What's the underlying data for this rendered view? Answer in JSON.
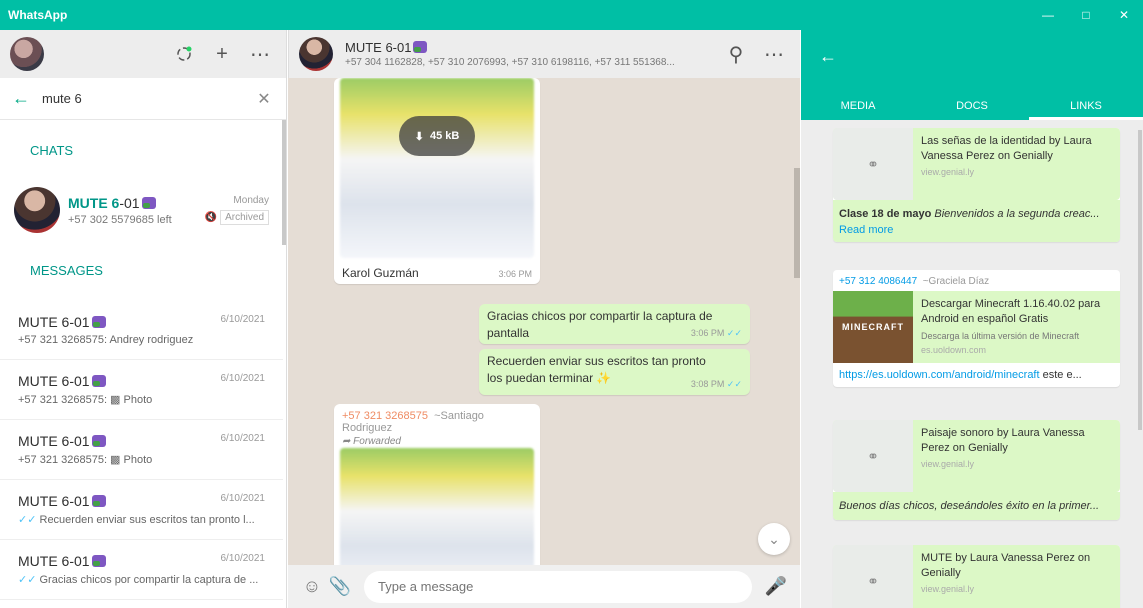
{
  "window": {
    "title": "WhatsApp"
  },
  "left": {
    "search_value": "mute 6",
    "section_chats": "CHATS",
    "section_messages": "MESSAGES",
    "chat": {
      "name_highlight": "MUTE 6",
      "name_rest": "-01",
      "sub": "+57 302 5579685 left",
      "time": "Monday",
      "badge": "Archived"
    },
    "messages": [
      {
        "name": "MUTE 6-01",
        "date": "6/10/2021",
        "preview": "+57 321 3268575: Andrey rodriguez"
      },
      {
        "name": "MUTE 6-01",
        "date": "6/10/2021",
        "preview": "+57 321 3268575: ▩ Photo"
      },
      {
        "name": "MUTE 6-01",
        "date": "6/10/2021",
        "preview": "+57 321 3268575: ▩ Photo"
      },
      {
        "name": "MUTE 6-01",
        "date": "6/10/2021",
        "preview": "Recuerden enviar sus escritos tan pronto l..."
      },
      {
        "name": "MUTE 6-01",
        "date": "6/10/2021",
        "preview": "Gracias chicos por compartir la captura de ..."
      }
    ]
  },
  "center": {
    "chat_name": "MUTE 6-01",
    "participants": "+57 304 1162828, +57 310 2076993, +57 310 6198116, +57 311 551368...",
    "bubbles": {
      "image1": {
        "download_size": "45 kB",
        "sender": "Karol Guzmán",
        "time": "3:06 PM"
      },
      "out1": {
        "text": "Gracias chicos por compartir la captura de pantalla",
        "time": "3:06 PM"
      },
      "out2": {
        "text": "Recuerden enviar sus escritos tan pronto los puedan terminar",
        "time": "3:08 PM"
      },
      "fwd": {
        "phone": "+57 321 3268575",
        "name": "~Santiago Rodriguez",
        "forwarded": "Forwarded"
      }
    },
    "composer_placeholder": "Type a message"
  },
  "right": {
    "tabs": [
      "MEDIA",
      "DOCS",
      "LINKS"
    ],
    "links": [
      {
        "title": "Las señas de la identidad by Laura Vanessa Perez on Genially",
        "site": "view.genial.ly",
        "text_bold": "Clase 18 de mayo",
        "text_italic": " Bienvenidos a la segunda creac...",
        "read_more": "Read more"
      },
      {
        "sender_phone": "+57 312 4086447",
        "sender_name": "~Graciela Díaz",
        "title": "Descargar Minecraft 1.16.40.02 para Android en español Gratis",
        "desc": "Descarga la última versión de Minecraft",
        "site": "es.uoldown.com",
        "thumb_text": "MINECRAFT",
        "url": "https://es.uoldown.com/android/minecraft",
        "url_rest": " este e..."
      },
      {
        "title": "Paisaje sonoro by Laura Vanessa Perez on Genially",
        "site": "view.genial.ly",
        "text_italic": "Buenos días chicos, deseándoles éxito en la primer..."
      },
      {
        "title": "MUTE by Laura Vanessa Perez on Genially",
        "site": "view.genial.ly"
      }
    ]
  },
  "colors": {
    "accent": "#00bfa5",
    "bubble_out": "#dcf8c6",
    "chat_bg": "#e5ddd5",
    "link": "#039be5"
  }
}
